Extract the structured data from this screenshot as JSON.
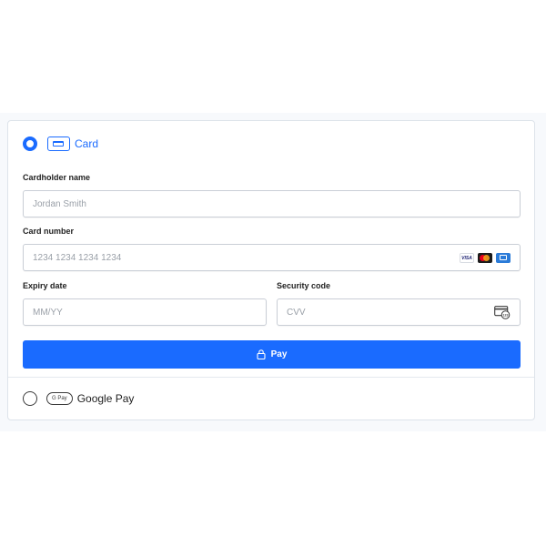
{
  "payment_options": {
    "card": {
      "label": "Card",
      "selected": true,
      "icon": "credit-card-icon"
    },
    "google_pay": {
      "label": "Google Pay",
      "badge": "G Pay",
      "selected": false,
      "icon": "google-pay-icon"
    }
  },
  "form": {
    "cardholder_name": {
      "label": "Cardholder name",
      "placeholder": "Jordan Smith",
      "value": ""
    },
    "card_number": {
      "label": "Card number",
      "placeholder": "1234 1234 1234 1234",
      "value": "",
      "brands": [
        "VISA",
        "mastercard",
        "amex"
      ]
    },
    "expiry": {
      "label": "Expiry date",
      "placeholder": "MM/YY",
      "value": ""
    },
    "security_code": {
      "label": "Security code",
      "placeholder": "CVV",
      "value": "",
      "icon": "cvc-card-icon"
    }
  },
  "pay_button": {
    "label": "Pay",
    "icon": "lock-icon"
  },
  "colors": {
    "accent": "#1a6bff",
    "border": "#c9ced6",
    "placeholder": "#9aa0a8"
  }
}
